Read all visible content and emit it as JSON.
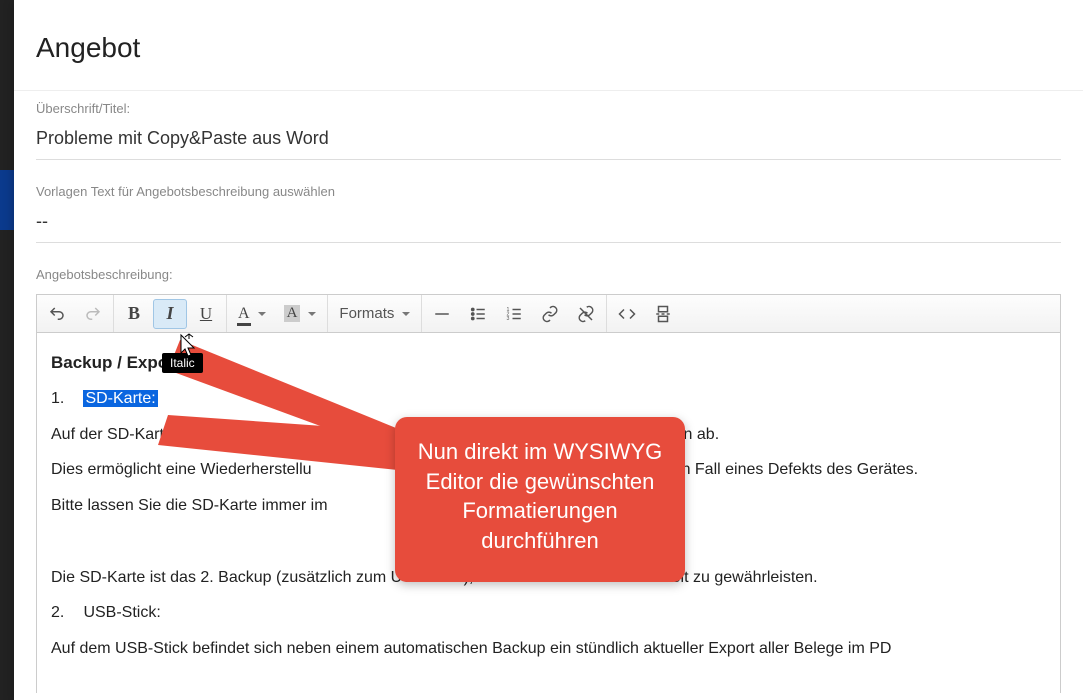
{
  "modal": {
    "title": "Angebot",
    "field1_label": "Überschrift/Titel:",
    "field1_value": "Probleme mit Copy&Paste aus Word",
    "field2_label": "Vorlagen Text für Angebotsbeschreibung auswählen",
    "field2_value": "--",
    "desc_label": "Angebotsbeschreibung:"
  },
  "toolbar": {
    "formats_label": "Formats",
    "tooltip_italic": "Italic"
  },
  "content": {
    "heading": "Backup / Export:",
    "li1_num": "1.",
    "li1_text": "SD-Karte:",
    "p1a": "Auf der SD-Karte legt da",
    "p1b": " Daten ab.",
    "p2a": "Dies ermöglicht eine Wiederherstellu",
    "p2b": "n Fall eines Defekts des Gerätes.",
    "p3": "Bitte lassen Sie die SD-Karte immer im",
    "p4": "Die SD-Karte ist das 2. Backup (zusätzlich zum USB-Stick), um maximale Datensicherheit zu gewährleisten.",
    "li2_num": "2.",
    "li2_text": "USB-Stick:",
    "p5": "Auf dem USB-Stick befindet sich neben einem automatischen Backup ein stündlich aktueller Export aller Belege im PD"
  },
  "callout": {
    "text": "Nun direkt im WYSIWYG Editor die gewünschten Formatierungen durchführen"
  }
}
